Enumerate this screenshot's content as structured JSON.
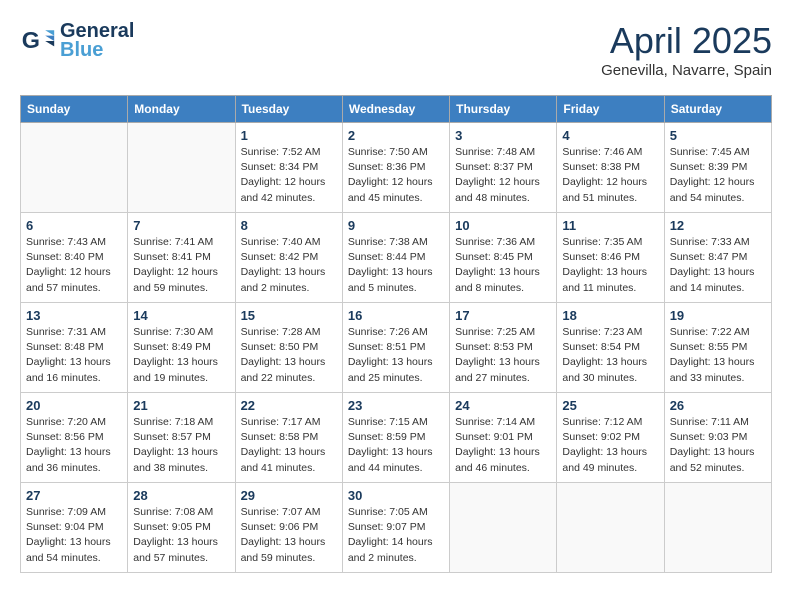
{
  "header": {
    "logo_line1": "General",
    "logo_line2": "Blue",
    "month_title": "April 2025",
    "subtitle": "Genevilla, Navarre, Spain"
  },
  "weekdays": [
    "Sunday",
    "Monday",
    "Tuesday",
    "Wednesday",
    "Thursday",
    "Friday",
    "Saturday"
  ],
  "weeks": [
    [
      {
        "day": "",
        "info": ""
      },
      {
        "day": "",
        "info": ""
      },
      {
        "day": "1",
        "info": "Sunrise: 7:52 AM\nSunset: 8:34 PM\nDaylight: 12 hours and 42 minutes."
      },
      {
        "day": "2",
        "info": "Sunrise: 7:50 AM\nSunset: 8:36 PM\nDaylight: 12 hours and 45 minutes."
      },
      {
        "day": "3",
        "info": "Sunrise: 7:48 AM\nSunset: 8:37 PM\nDaylight: 12 hours and 48 minutes."
      },
      {
        "day": "4",
        "info": "Sunrise: 7:46 AM\nSunset: 8:38 PM\nDaylight: 12 hours and 51 minutes."
      },
      {
        "day": "5",
        "info": "Sunrise: 7:45 AM\nSunset: 8:39 PM\nDaylight: 12 hours and 54 minutes."
      }
    ],
    [
      {
        "day": "6",
        "info": "Sunrise: 7:43 AM\nSunset: 8:40 PM\nDaylight: 12 hours and 57 minutes."
      },
      {
        "day": "7",
        "info": "Sunrise: 7:41 AM\nSunset: 8:41 PM\nDaylight: 12 hours and 59 minutes."
      },
      {
        "day": "8",
        "info": "Sunrise: 7:40 AM\nSunset: 8:42 PM\nDaylight: 13 hours and 2 minutes."
      },
      {
        "day": "9",
        "info": "Sunrise: 7:38 AM\nSunset: 8:44 PM\nDaylight: 13 hours and 5 minutes."
      },
      {
        "day": "10",
        "info": "Sunrise: 7:36 AM\nSunset: 8:45 PM\nDaylight: 13 hours and 8 minutes."
      },
      {
        "day": "11",
        "info": "Sunrise: 7:35 AM\nSunset: 8:46 PM\nDaylight: 13 hours and 11 minutes."
      },
      {
        "day": "12",
        "info": "Sunrise: 7:33 AM\nSunset: 8:47 PM\nDaylight: 13 hours and 14 minutes."
      }
    ],
    [
      {
        "day": "13",
        "info": "Sunrise: 7:31 AM\nSunset: 8:48 PM\nDaylight: 13 hours and 16 minutes."
      },
      {
        "day": "14",
        "info": "Sunrise: 7:30 AM\nSunset: 8:49 PM\nDaylight: 13 hours and 19 minutes."
      },
      {
        "day": "15",
        "info": "Sunrise: 7:28 AM\nSunset: 8:50 PM\nDaylight: 13 hours and 22 minutes."
      },
      {
        "day": "16",
        "info": "Sunrise: 7:26 AM\nSunset: 8:51 PM\nDaylight: 13 hours and 25 minutes."
      },
      {
        "day": "17",
        "info": "Sunrise: 7:25 AM\nSunset: 8:53 PM\nDaylight: 13 hours and 27 minutes."
      },
      {
        "day": "18",
        "info": "Sunrise: 7:23 AM\nSunset: 8:54 PM\nDaylight: 13 hours and 30 minutes."
      },
      {
        "day": "19",
        "info": "Sunrise: 7:22 AM\nSunset: 8:55 PM\nDaylight: 13 hours and 33 minutes."
      }
    ],
    [
      {
        "day": "20",
        "info": "Sunrise: 7:20 AM\nSunset: 8:56 PM\nDaylight: 13 hours and 36 minutes."
      },
      {
        "day": "21",
        "info": "Sunrise: 7:18 AM\nSunset: 8:57 PM\nDaylight: 13 hours and 38 minutes."
      },
      {
        "day": "22",
        "info": "Sunrise: 7:17 AM\nSunset: 8:58 PM\nDaylight: 13 hours and 41 minutes."
      },
      {
        "day": "23",
        "info": "Sunrise: 7:15 AM\nSunset: 8:59 PM\nDaylight: 13 hours and 44 minutes."
      },
      {
        "day": "24",
        "info": "Sunrise: 7:14 AM\nSunset: 9:01 PM\nDaylight: 13 hours and 46 minutes."
      },
      {
        "day": "25",
        "info": "Sunrise: 7:12 AM\nSunset: 9:02 PM\nDaylight: 13 hours and 49 minutes."
      },
      {
        "day": "26",
        "info": "Sunrise: 7:11 AM\nSunset: 9:03 PM\nDaylight: 13 hours and 52 minutes."
      }
    ],
    [
      {
        "day": "27",
        "info": "Sunrise: 7:09 AM\nSunset: 9:04 PM\nDaylight: 13 hours and 54 minutes."
      },
      {
        "day": "28",
        "info": "Sunrise: 7:08 AM\nSunset: 9:05 PM\nDaylight: 13 hours and 57 minutes."
      },
      {
        "day": "29",
        "info": "Sunrise: 7:07 AM\nSunset: 9:06 PM\nDaylight: 13 hours and 59 minutes."
      },
      {
        "day": "30",
        "info": "Sunrise: 7:05 AM\nSunset: 9:07 PM\nDaylight: 14 hours and 2 minutes."
      },
      {
        "day": "",
        "info": ""
      },
      {
        "day": "",
        "info": ""
      },
      {
        "day": "",
        "info": ""
      }
    ]
  ]
}
